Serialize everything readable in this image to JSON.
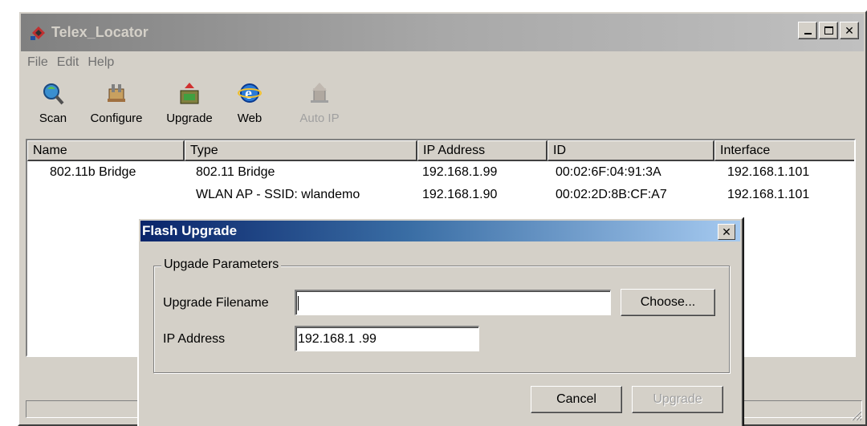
{
  "window": {
    "title": "Telex_Locator",
    "accent": "#0a246a"
  },
  "menu": {
    "items": [
      "File",
      "Edit",
      "Help"
    ]
  },
  "toolbar": {
    "buttons": [
      {
        "label": "Scan",
        "icon": "scan-icon",
        "enabled": true
      },
      {
        "label": "Configure",
        "icon": "configure-icon",
        "enabled": true
      },
      {
        "label": "Upgrade",
        "icon": "upgrade-icon",
        "enabled": true
      },
      {
        "label": "Web",
        "icon": "web-browser-icon",
        "enabled": true
      },
      {
        "label": "Auto IP",
        "icon": "auto-ip-icon",
        "enabled": false
      }
    ]
  },
  "device_list": {
    "columns": [
      "Name",
      "Type",
      "IP Address",
      "ID",
      "Interface"
    ],
    "rows": [
      {
        "name": "802.11b Bridge",
        "type": "802.11 Bridge",
        "ip": "192.168.1.99",
        "id": "00:02:6F:04:91:3A",
        "interface": "192.168.1.101"
      },
      {
        "name": "",
        "type": "WLAN AP - SSID: wlandemo",
        "ip": "192.168.1.90",
        "id": "00:02:2D:8B:CF:A7",
        "interface": "192.168.1.101"
      }
    ]
  },
  "dialog": {
    "title": "Flash Upgrade",
    "group_label": "Upgade Parameters",
    "filename_label": "Upgrade Filename",
    "filename_value": "",
    "choose_label": "Choose...",
    "ip_label": "IP Address",
    "ip_value": "192.168.1  .99",
    "cancel_label": "Cancel",
    "upgrade_label": "Upgrade"
  }
}
